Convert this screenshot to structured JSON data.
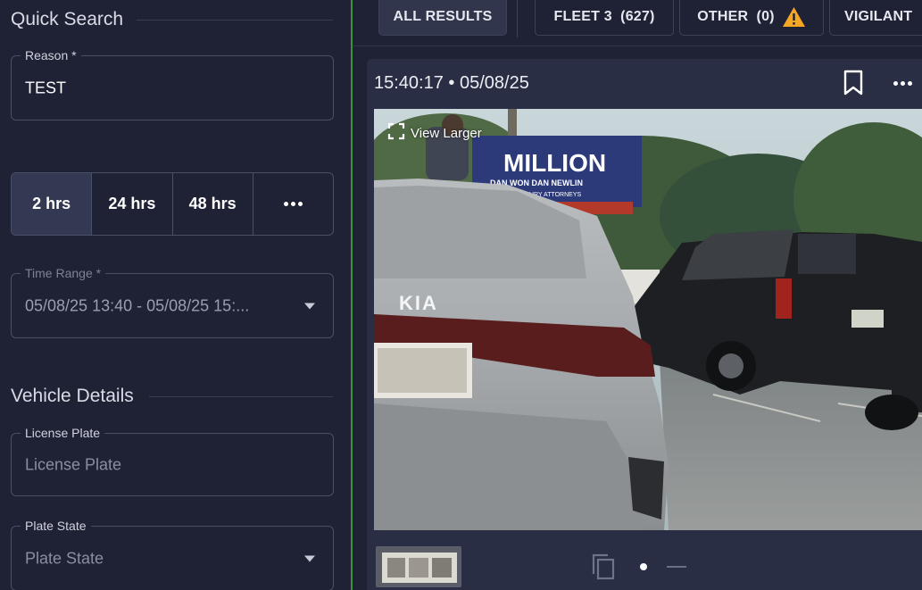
{
  "quick_search": {
    "title": "Quick Search",
    "reason": {
      "label": "Reason *",
      "value": "TEST"
    },
    "time_presets": [
      "2 hrs",
      "24 hrs",
      "48 hrs"
    ],
    "active_preset": "2 hrs",
    "more_icon": "more-horizontal-icon",
    "time_range": {
      "label": "Time Range *",
      "value": "05/08/25 13:40 - 05/08/25 15:..."
    }
  },
  "vehicle_details": {
    "title": "Vehicle Details",
    "license_plate": {
      "label": "License Plate",
      "placeholder": "License Plate"
    },
    "plate_state": {
      "label": "Plate State",
      "placeholder": "Plate State"
    }
  },
  "tabs": [
    {
      "label": "ALL RESULTS",
      "active": true
    },
    {
      "label": "FLEET 3  (627)",
      "active": false
    },
    {
      "label": "OTHER  (0)",
      "active": false,
      "icon": "warning-icon",
      "icon_color": "#f5a623"
    },
    {
      "label": "VIGILANT",
      "active": false
    }
  ],
  "result_card": {
    "timestamp": "15:40:17 • 05/08/25",
    "view_larger": "View Larger",
    "billboard_headline": "MILLION",
    "billboard_line1": "DAN WON    DAN NEWLIN",
    "billboard_line2": "PI CASE!!    INJURY ATTORNEYS",
    "car_brand": "KIA",
    "icons": [
      "bookmark-icon",
      "more-horizontal-icon",
      "expand-icon",
      "copy-icon"
    ]
  },
  "colors": {
    "accent_green": "#3f8f3f",
    "panel_bg": "#1f2235",
    "card_bg": "#2a2e44",
    "warning": "#f5a623"
  }
}
